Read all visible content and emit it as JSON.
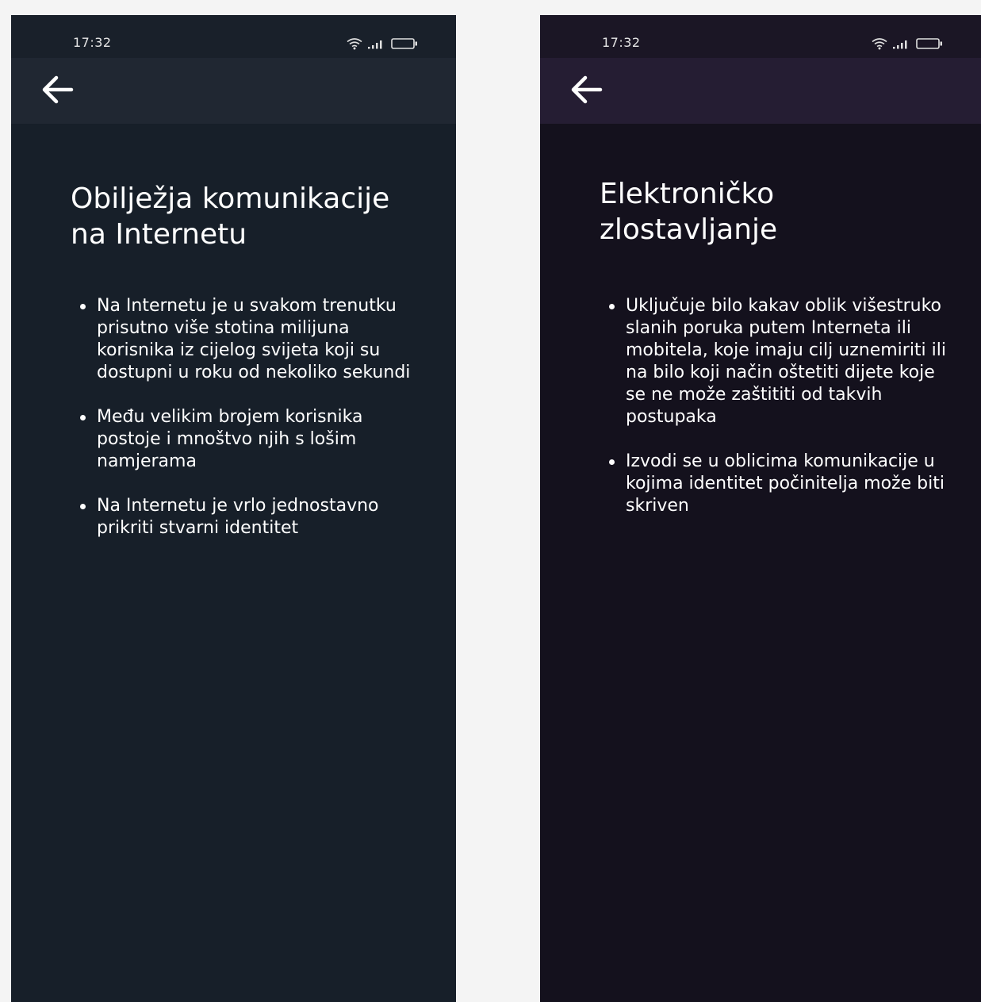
{
  "screens": [
    {
      "status_time": "17:32",
      "title": "Obilježja komunikacije na Internetu",
      "bullets": [
        "Na Internetu je u svakom trenutku prisutno više stotina milijuna korisnika iz cijelog svijeta koji su dostupni u roku od nekoliko sekundi",
        "Među velikim brojem korisnika postoje i mnoštvo njih s lošim namjerama",
        "Na Internetu je vrlo jednostavno prikriti stvarni identitet"
      ],
      "colors": {
        "background": "#171f29",
        "status_bar": "#19202a",
        "app_bar": "#202732"
      }
    },
    {
      "status_time": "17:32",
      "title": "Elektroničko zlostavljanje",
      "bullets": [
        "Uključuje bilo kakav oblik višestruko slanih poruka putem Interneta ili mobitela, koje imaju cilj uznemiriti ili na bilo koji način oštetiti dijete koje se ne može zaštititi od takvih postupaka",
        "Izvodi se u oblicima komunikacije u kojima identitet počinitelja može biti skriven"
      ],
      "colors": {
        "background": "#14111d",
        "status_bar": "#1b1625",
        "app_bar": "#251d33"
      }
    }
  ],
  "icons": {
    "back": "arrow-left-icon",
    "wifi": "wifi-icon",
    "signal": "signal-icon",
    "battery": "battery-icon"
  },
  "colors": {
    "canvas": "#f4f4f4",
    "text": "#ffffff"
  }
}
